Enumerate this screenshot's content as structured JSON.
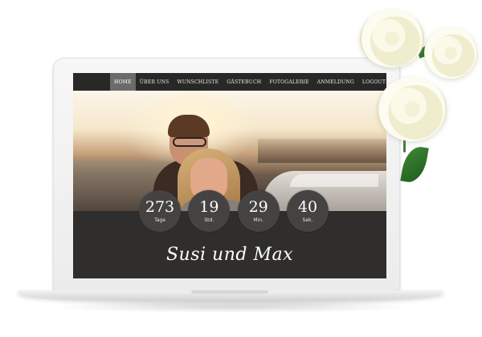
{
  "nav": {
    "items": [
      {
        "label": "HOME",
        "active": true
      },
      {
        "label": "ÜBER UNS",
        "active": false
      },
      {
        "label": "WUNSCHLISTE",
        "active": false
      },
      {
        "label": "GÄSTEBUCH",
        "active": false
      },
      {
        "label": "FOTOGALERIE",
        "active": false
      },
      {
        "label": "ANMELDUNG",
        "active": false
      },
      {
        "label": "LOGOUT",
        "active": false
      }
    ]
  },
  "countdown": [
    {
      "value": "273",
      "unit": "Tage"
    },
    {
      "value": "19",
      "unit": "Std."
    },
    {
      "value": "29",
      "unit": "Min."
    },
    {
      "value": "40",
      "unit": "Sek."
    }
  ],
  "couple": {
    "names": "Susi und Max"
  },
  "colors": {
    "nav_bg": "#292827",
    "nav_active": "#6d6b69",
    "panel_bg": "#2f2e2d",
    "circle_bg": "#454342"
  }
}
